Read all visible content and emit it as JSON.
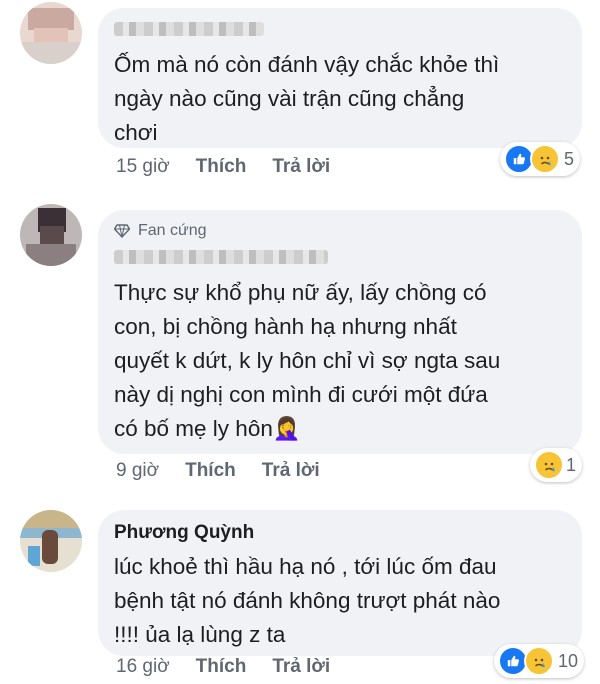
{
  "comments": [
    {
      "text_lines": [
        "Ốm mà nó còn đánh vậy chắc khỏe thì",
        "ngày nào cũng vài trận cũng chẳng",
        "chơi"
      ],
      "time": "15 giờ",
      "like_label": "Thích",
      "reply_label": "Trả lời",
      "reaction_count": "5",
      "reactions": [
        "like-icon",
        "sad-icon"
      ]
    },
    {
      "badge": "Fan cứng",
      "text_lines": [
        "Thực sự khổ phụ nữ ấy, lấy chồng có",
        "con, bị chồng hành hạ nhưng nhất",
        "quyết k dứt, k ly hôn chỉ vì sợ ngta sau",
        "này dị nghị con mình đi cưới một đứa",
        "có bố mẹ ly hôn"
      ],
      "emoji": "🤦‍♀️",
      "time": "9 giờ",
      "like_label": "Thích",
      "reply_label": "Trả lời",
      "reaction_count": "1",
      "reactions": [
        "sad-icon"
      ]
    },
    {
      "author": "Phương Quỳnh",
      "text_lines": [
        "lúc khoẻ thì hầu hạ nó , tới lúc ốm đau",
        "bệnh tật nó đánh không trượt phát nào",
        "!!!! ủa lạ lùng z ta"
      ],
      "time": "16 giờ",
      "like_label": "Thích",
      "reply_label": "Trả lời",
      "reaction_count": "10",
      "reactions": [
        "like-icon",
        "sad-icon"
      ]
    }
  ],
  "colors": {
    "bubble": "#f0f2f5",
    "meta_text": "#606770",
    "like_blue": "#1877f2",
    "sad_yellow": "#f7c436"
  }
}
